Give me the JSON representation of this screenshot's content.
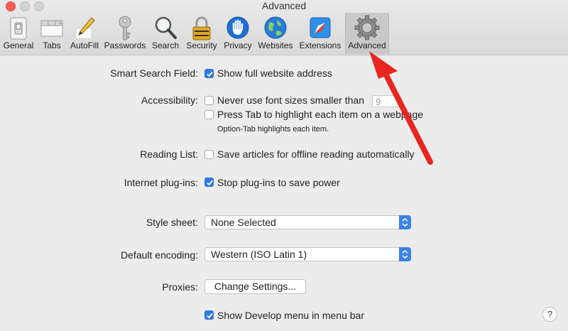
{
  "window": {
    "title": "Advanced"
  },
  "colors": {
    "accent": "#2f7ce3",
    "annotation_arrow": "#e8251f",
    "traffic_close": "#fc5b57"
  },
  "toolbar": {
    "items": [
      {
        "label": "General",
        "icon": "general-switch-icon"
      },
      {
        "label": "Tabs",
        "icon": "tabs-icon"
      },
      {
        "label": "AutoFill",
        "icon": "autofill-pencil-icon"
      },
      {
        "label": "Passwords",
        "icon": "key-icon"
      },
      {
        "label": "Search",
        "icon": "magnifier-icon"
      },
      {
        "label": "Security",
        "icon": "padlock-icon"
      },
      {
        "label": "Privacy",
        "icon": "hand-icon"
      },
      {
        "label": "Websites",
        "icon": "globe-icon"
      },
      {
        "label": "Extensions",
        "icon": "puzzle-compass-icon"
      },
      {
        "label": "Advanced",
        "icon": "gear-icon",
        "selected": true
      }
    ]
  },
  "settings": {
    "smart_search": {
      "label": "Smart Search Field:",
      "option": "Show full website address",
      "checked": true
    },
    "accessibility": {
      "label": "Accessibility:",
      "option1": "Never use font sizes smaller than",
      "option1_checked": false,
      "font_size_value": "9",
      "option2": "Press Tab to highlight each item on a webpage",
      "option2_checked": false,
      "hint": "Option-Tab highlights each item."
    },
    "reading_list": {
      "label": "Reading List:",
      "option": "Save articles for offline reading automatically",
      "checked": false
    },
    "plugins": {
      "label": "Internet plug-ins:",
      "option": "Stop plug-ins to save power",
      "checked": true
    },
    "style_sheet": {
      "label": "Style sheet:",
      "value": "None Selected"
    },
    "encoding": {
      "label": "Default encoding:",
      "value": "Western (ISO Latin 1)"
    },
    "proxies": {
      "label": "Proxies:",
      "button": "Change Settings..."
    },
    "develop": {
      "option": "Show Develop menu in menu bar",
      "checked": true
    }
  },
  "help": {
    "label": "?"
  }
}
